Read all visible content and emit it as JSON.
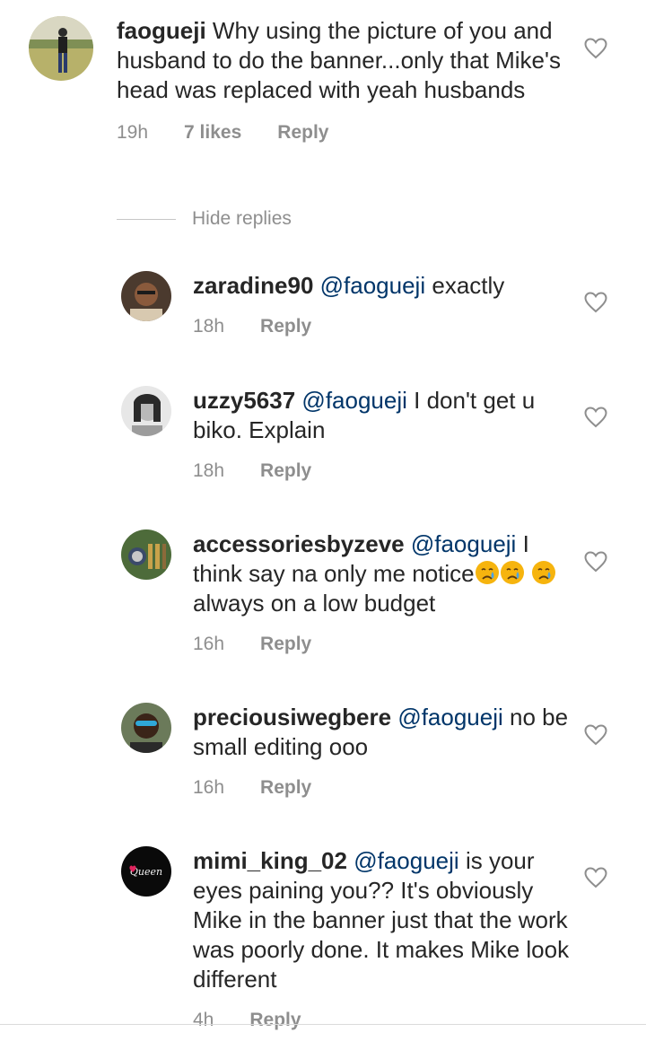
{
  "colors": {
    "text": "#262626",
    "mention": "#003569",
    "muted": "#8e8e8e"
  },
  "main_comment": {
    "username": "faogueji",
    "text": "Why using the picture of you and husband to do the banner...only that Mike's head was replaced with yeah husbands",
    "time": "19h",
    "likes": "7 likes",
    "reply": "Reply",
    "heart_icon": "heart-outline-icon"
  },
  "hide_replies": "Hide replies",
  "replies": [
    {
      "username": "zaradine90",
      "mention": "@faogueji",
      "text": "exactly",
      "time": "18h",
      "reply": "Reply"
    },
    {
      "username": "uzzy5637",
      "mention": "@faogueji",
      "text": "I don't get u biko. Explain",
      "time": "18h",
      "reply": "Reply"
    },
    {
      "username": "accessoriesbyzeve",
      "mention": "@faogueji",
      "text_before": "I think say na only me notice",
      "text_after": "always on a low budget",
      "emoji": "crying-face-emoji",
      "time": "16h",
      "reply": "Reply"
    },
    {
      "username": "preciousiwegbere",
      "mention": "@faogueji",
      "text": "no be small editing ooo",
      "time": "16h",
      "reply": "Reply"
    },
    {
      "username": "mimi_king_02",
      "mention": "@faogueji",
      "text": "is your eyes paining you?? It's obviously Mike in the banner just that the work was poorly done. It makes Mike look different",
      "time": "4h",
      "reply": "Reply",
      "avatar_text": "Queen"
    }
  ]
}
